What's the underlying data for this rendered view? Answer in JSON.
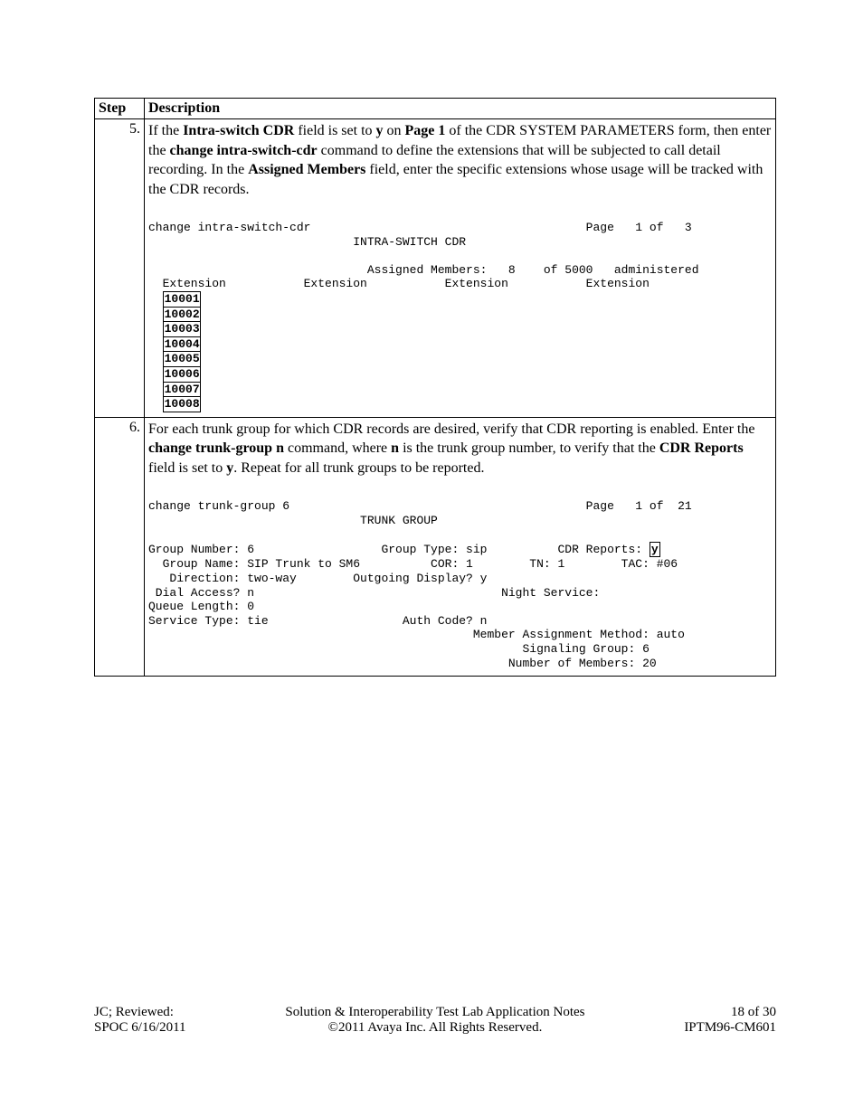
{
  "header": {
    "step_label": "Step",
    "description_label": "Description"
  },
  "steps": [
    {
      "number": "5.",
      "desc_pre": "If the ",
      "desc_b1": "Intra-switch CDR",
      "desc_mid1": " field is set to ",
      "desc_b2": "y",
      "desc_mid2": " on ",
      "desc_b3": "Page 1",
      "desc_mid3": " of the CDR SYSTEM PARAMETERS form, then enter the ",
      "desc_b4": "change intra-switch-cdr",
      "desc_mid4": " command to define the extensions that will be subjected to call detail recording. In the ",
      "desc_b5": "Assigned Members",
      "desc_end": " field, enter the specific extensions whose usage will be tracked with the CDR records.",
      "term_line1": "change intra-switch-cdr                                       Page   1 of   3",
      "term_line2": "                             INTRA-SWITCH CDR",
      "term_line3": "                               Assigned Members:   8    of 5000   administered",
      "term_line4": "  Extension           Extension           Extension           Extension",
      "extensions": [
        "10001",
        "10002",
        "10003",
        "10004",
        "10005",
        "10006",
        "10007",
        "10008"
      ]
    },
    {
      "number": "6.",
      "desc_pre": "For each trunk group for which CDR records are desired, verify that CDR reporting is enabled. Enter the ",
      "desc_b1": "change trunk-group n",
      "desc_mid1": " command, where ",
      "desc_b2": "n",
      "desc_mid2": " is the trunk group number, to verify that the ",
      "desc_b3": "CDR Reports",
      "desc_mid3": " field is set to ",
      "desc_b4": "y",
      "desc_end": ". Repeat for all trunk groups to be reported.",
      "term_line1": "change trunk-group 6                                          Page   1 of  21",
      "term_line2": "                              TRUNK GROUP",
      "term_line3_pre": "Group Number: 6                  Group Type: sip          CDR Reports: ",
      "term_line3_y": "y",
      "term_line4": "  Group Name: SIP Trunk to SM6          COR: 1        TN: 1        TAC: #06",
      "term_line5": "   Direction: two-way        Outgoing Display? y",
      "term_line6": " Dial Access? n                                   Night Service:",
      "term_line7": "Queue Length: 0",
      "term_line8": "Service Type: tie                   Auth Code? n",
      "term_line9": "                                              Member Assignment Method: auto",
      "term_line10": "                                                     Signaling Group: 6",
      "term_line11": "                                                   Number of Members: 20"
    }
  ],
  "footer": {
    "left1": "JC; Reviewed:",
    "left2": "SPOC 6/16/2011",
    "center1": "Solution & Interoperability Test Lab Application Notes",
    "center2": "©2011 Avaya Inc. All Rights Reserved.",
    "right1": "18 of 30",
    "right2": "IPTM96-CM601"
  }
}
